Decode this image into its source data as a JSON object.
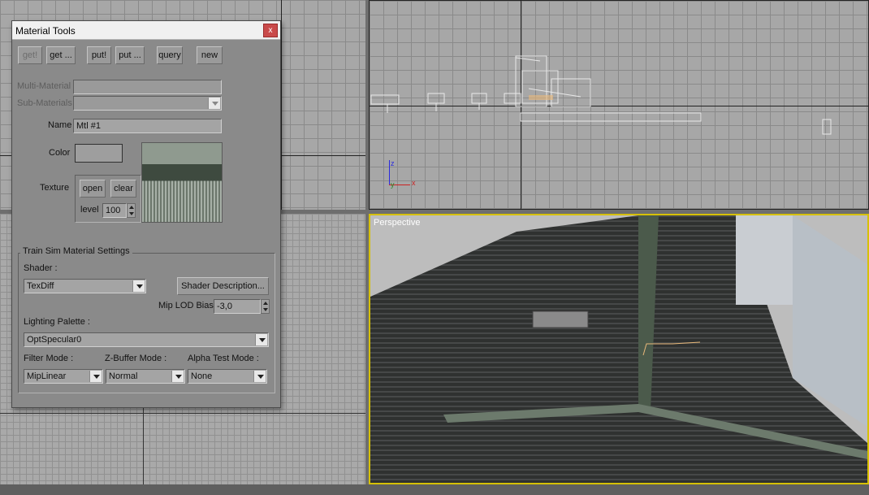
{
  "dialog": {
    "title": "Material Tools",
    "close_label": "x",
    "toolbar": {
      "get_label": "get!",
      "get_more_label": "get ...",
      "put_label": "put!",
      "put_more_label": "put ...",
      "query_label": "query",
      "new_label": "new"
    },
    "multi_material": {
      "label": "Multi-Material",
      "value": ""
    },
    "sub_materials": {
      "label": "Sub-Materials",
      "value": ""
    },
    "name": {
      "label": "Name",
      "value": "Mtl #1"
    },
    "color": {
      "label": "Color",
      "swatch": "#9e9e9e"
    },
    "texture": {
      "label": "Texture",
      "open_label": "open",
      "clear_label": "clear",
      "level_label": "level",
      "level_value": "100"
    },
    "train_sim": {
      "group_title": "Train Sim Material Settings",
      "shader_label": "Shader :",
      "shader_value": "TexDiff",
      "shader_description_label": "Shader Description...",
      "mip_lod_bias_label": "Mip LOD Bias",
      "mip_lod_bias_value": "-3,0",
      "lighting_palette_label": "Lighting Palette :",
      "lighting_palette_value": "OptSpecular0",
      "filter_mode_label": "Filter Mode :",
      "filter_mode_value": "MipLinear",
      "zbuffer_mode_label": "Z-Buffer Mode :",
      "zbuffer_mode_value": "Normal",
      "alpha_test_mode_label": "Alpha Test Mode :",
      "alpha_test_mode_value": "None"
    }
  },
  "viewports": {
    "perspective_label": "Perspective",
    "axis_z": "z",
    "axis_y": "y",
    "axis_x": "x"
  }
}
